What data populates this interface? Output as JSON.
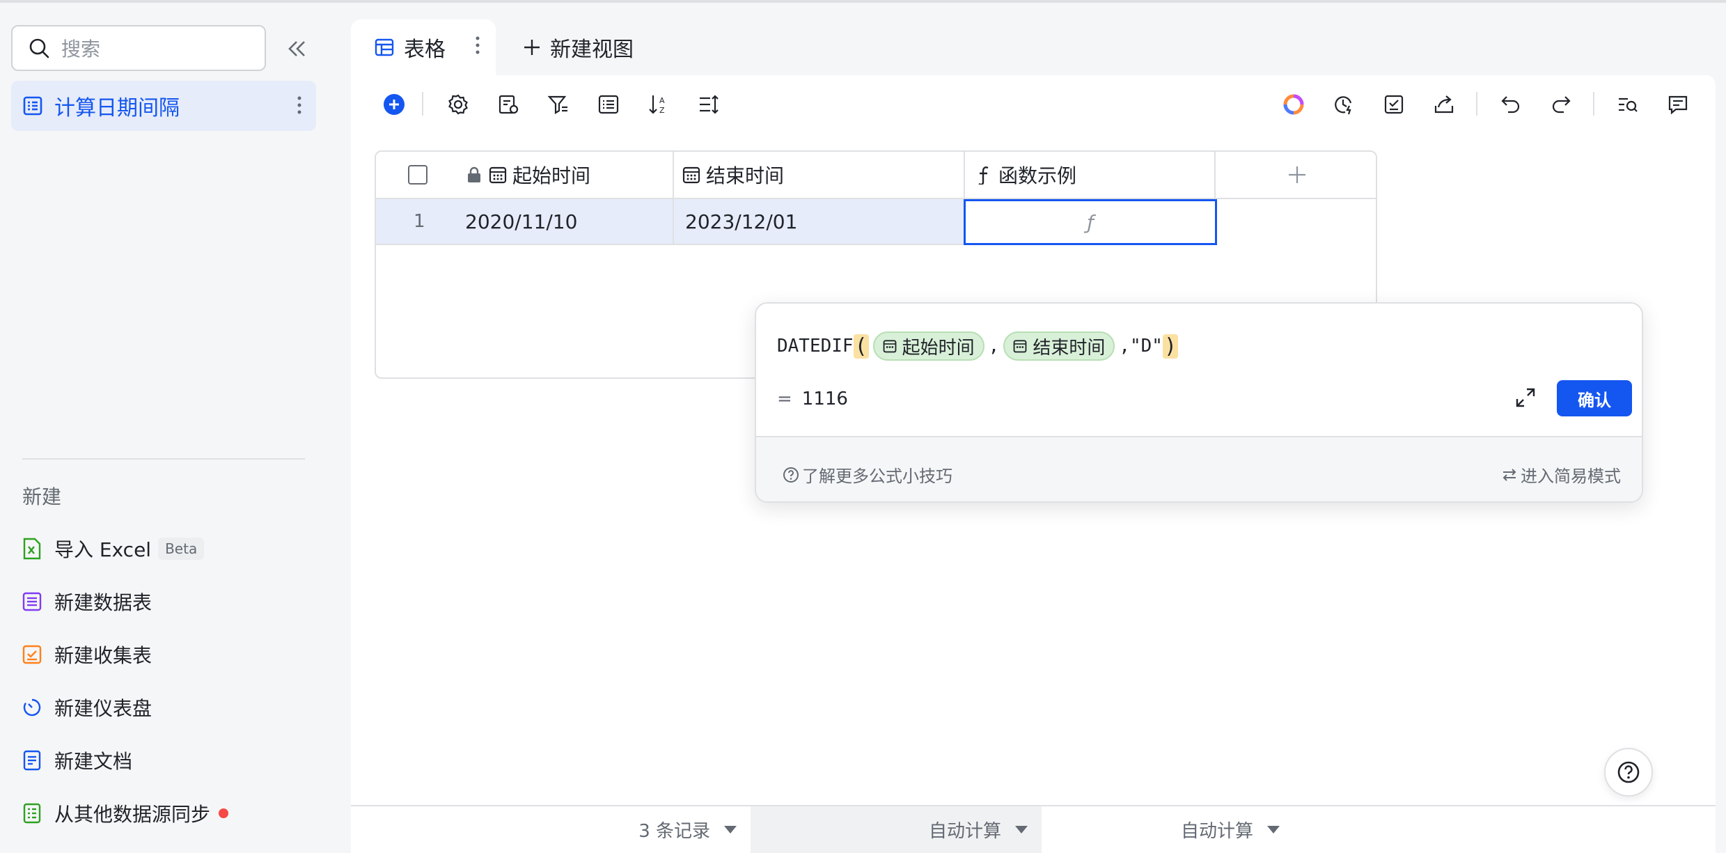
{
  "sidebar": {
    "search_placeholder": "搜索",
    "table_item": "计算日期间隔",
    "new_section_title": "新建",
    "new_items": [
      {
        "label": "导入 Excel",
        "badge": "Beta"
      },
      {
        "label": "新建数据表"
      },
      {
        "label": "新建收集表"
      },
      {
        "label": "新建仪表盘"
      },
      {
        "label": "新建文档"
      },
      {
        "label": "从其他数据源同步"
      }
    ]
  },
  "tabs": {
    "active": "表格",
    "new_view": "新建视图"
  },
  "grid": {
    "columns": [
      "起始时间",
      "结束时间",
      "函数示例"
    ],
    "rows": [
      {
        "index": "1",
        "start": "2020/11/10",
        "end": "2023/12/01",
        "formula_cell": "ƒ"
      }
    ]
  },
  "formula_editor": {
    "func_name": "DATEDIF",
    "open_paren": "(",
    "field1": "起始时间",
    "comma1": ",",
    "field2": "结束时间",
    "comma2": ",",
    "arg3": "\"D\"",
    "close_paren": ")",
    "equals": "=",
    "result": "1116",
    "confirm_label": "确认",
    "tips_link": "了解更多公式小技巧",
    "simple_mode": "进入简易模式"
  },
  "status_bar": {
    "records": "3 条记录",
    "calc1": "自动计算",
    "calc2": "自动计算"
  },
  "colors": {
    "accent": "#1456f0",
    "chip_bg": "#d9f0d8",
    "paren_bg": "#fbe1a1"
  }
}
